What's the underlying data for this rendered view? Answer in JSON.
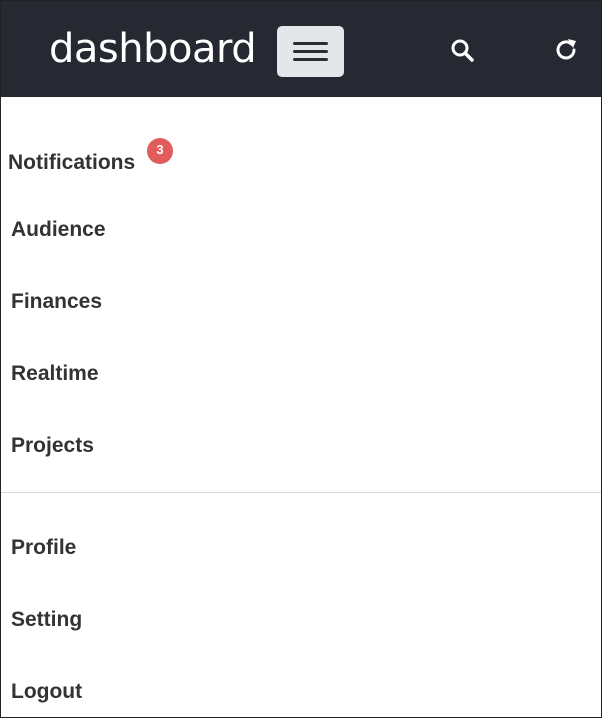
{
  "header": {
    "brand": "dashboard",
    "menu_icon": "hamburger-icon",
    "search_icon": "search-icon",
    "refresh_icon": "refresh-icon",
    "background_color": "#262932"
  },
  "notifications": {
    "label": "Notifications",
    "badge_count": "3",
    "badge_color": "#e25c5c"
  },
  "nav": {
    "primary": [
      "Audience",
      "Finances",
      "Realtime",
      "Projects"
    ],
    "secondary": [
      "Profile",
      "Setting",
      "Logout"
    ]
  }
}
